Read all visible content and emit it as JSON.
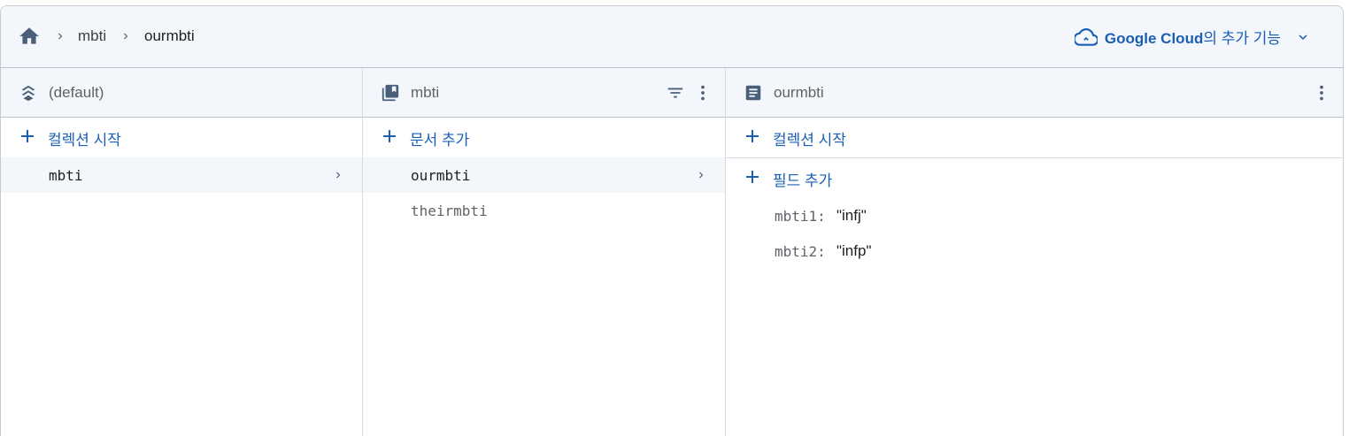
{
  "breadcrumb": {
    "home_icon": "home-icon",
    "items": [
      "mbti",
      "ourmbti"
    ]
  },
  "google_cloud": {
    "brand": "Google Cloud",
    "suffix": "의 추가 기능",
    "icon": "cloud-icon"
  },
  "columns": {
    "database": {
      "title": "(default)",
      "icon": "database-stack-icon",
      "add_label": "컬렉션 시작",
      "items": [
        {
          "label": "mbti",
          "selected": true
        }
      ]
    },
    "collection": {
      "title": "mbti",
      "icon": "collection-icon",
      "add_label": "문서 추가",
      "items": [
        {
          "label": "ourmbti",
          "selected": true
        },
        {
          "label": "theirmbti",
          "selected": false
        }
      ]
    },
    "document": {
      "title": "ourmbti",
      "icon": "document-icon",
      "add_collection_label": "컬렉션 시작",
      "add_field_label": "필드 추가",
      "fields": [
        {
          "key": "mbti1:",
          "value": "\"infj\""
        },
        {
          "key": "mbti2:",
          "value": "\"infp\""
        }
      ]
    }
  },
  "colors": {
    "accent": "#1a5fb4",
    "header_bg": "#f3f6fb",
    "icon": "#4a5f7a"
  }
}
